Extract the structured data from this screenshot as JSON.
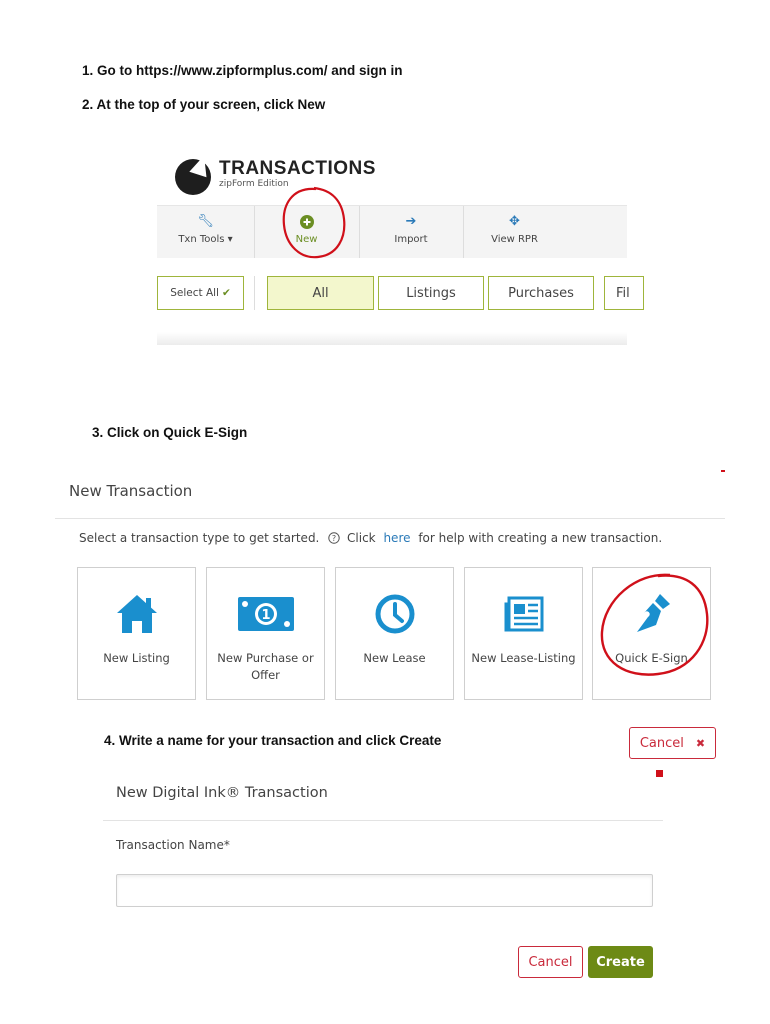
{
  "steps": {
    "s1": "1. Go to https://www.zipformplus.com/ and sign in",
    "s2": "2. At the top of your screen, click New",
    "s3": "3. Click on Quick E-Sign",
    "s4": "4. Write a name for your transaction and click Create"
  },
  "transactions_app": {
    "logo_title": "TRANSACTIONS",
    "logo_subtitle": "zipForm Edition",
    "toolbar": [
      {
        "label": "Txn Tools ▾",
        "icon": "wrench-icon"
      },
      {
        "label": "New",
        "icon": "plus-circle-icon"
      },
      {
        "label": "Import",
        "icon": "import-icon"
      },
      {
        "label": "View RPR",
        "icon": "rpr-icon"
      }
    ],
    "select_all": "Select All",
    "filters": [
      "All",
      "Listings",
      "Purchases",
      "Fil"
    ]
  },
  "new_transaction": {
    "title": "New Transaction",
    "intro_prefix": "Select a transaction type to get started.",
    "intro_click": "Click",
    "intro_link": "here",
    "intro_suffix": "for help with creating a new transaction.",
    "types": [
      {
        "label": "New Listing",
        "icon": "house-icon"
      },
      {
        "label": "New Purchase or Offer",
        "icon": "money-icon"
      },
      {
        "label": "New Lease",
        "icon": "clock-icon"
      },
      {
        "label": "New Lease-Listing",
        "icon": "newspaper-icon"
      },
      {
        "label": "Quick E-Sign",
        "icon": "pen-nib-icon"
      }
    ]
  },
  "digital_ink": {
    "cancel_top": "Cancel",
    "title": "New Digital Ink® Transaction",
    "name_label": "Transaction Name*",
    "name_value": "",
    "cancel": "Cancel",
    "create": "Create"
  },
  "colors": {
    "accent_green": "#6d8a15",
    "link_blue": "#2a7ab8",
    "icon_blue": "#1a8fce",
    "annotation_red": "#d0101a",
    "cancel_red": "#c92a3b"
  }
}
